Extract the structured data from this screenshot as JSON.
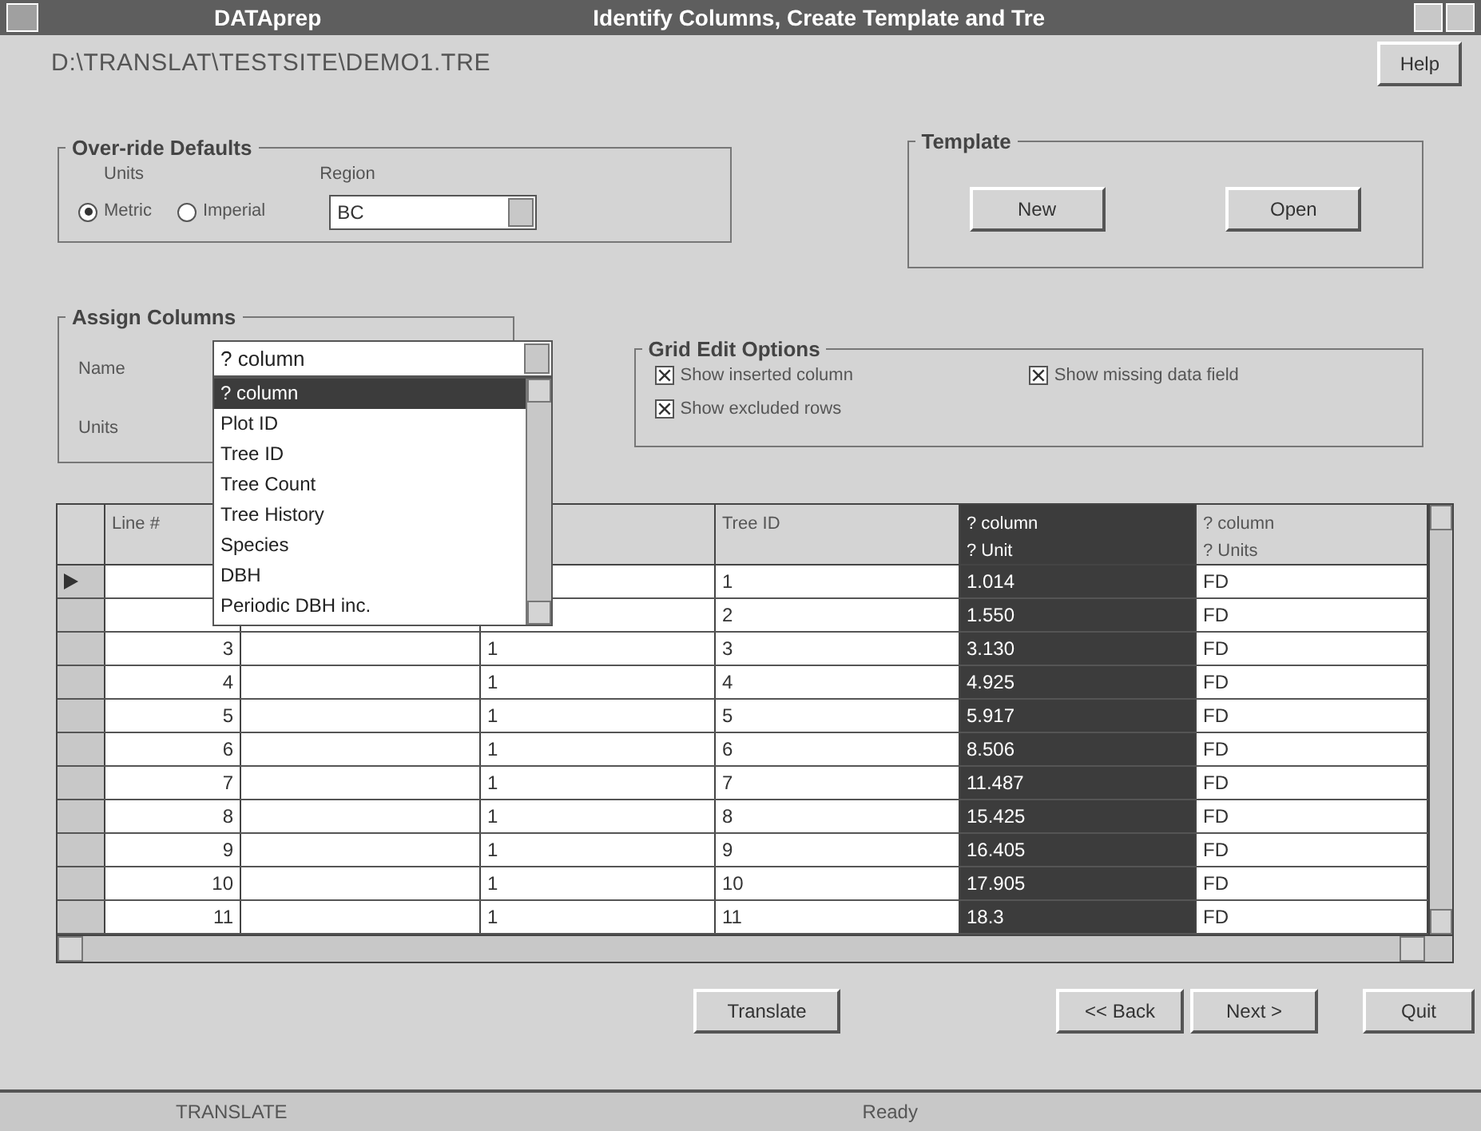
{
  "window": {
    "app_title": "DATAprep",
    "title": "Identify Columns, Create Template and Tre",
    "help_button": "Help"
  },
  "path": "D:\\TRANSLAT\\TESTSITE\\DEMO1.TRE",
  "override_defaults": {
    "title": "Over-ride Defaults",
    "units_label": "Units",
    "units": [
      {
        "label": "Metric",
        "selected": true
      },
      {
        "label": "Imperial",
        "selected": false
      }
    ],
    "region_label": "Region",
    "region": "BC"
  },
  "template": {
    "title": "Template",
    "buttons": [
      "New",
      "Open"
    ]
  },
  "assign_columns": {
    "title": "Assign Columns",
    "name_label": "Name",
    "units_label": "Units",
    "name_value": "? column",
    "options": [
      {
        "label": "? column",
        "selected": true
      },
      {
        "label": "Plot ID",
        "selected": false
      },
      {
        "label": "Tree ID",
        "selected": false
      },
      {
        "label": "Tree Count",
        "selected": false
      },
      {
        "label": "Tree History",
        "selected": false
      },
      {
        "label": "Species",
        "selected": false
      },
      {
        "label": "DBH",
        "selected": false
      },
      {
        "label": "Periodic DBH inc.",
        "selected": false
      }
    ]
  },
  "grid_edit_options": {
    "title": "Grid Edit Options",
    "options": [
      {
        "label": "Show inserted column",
        "checked": true
      },
      {
        "label": "Show missing data field",
        "checked": true
      },
      {
        "label": "Show excluded rows",
        "checked": true
      }
    ]
  },
  "table": {
    "columns": [
      {
        "label": "Line #",
        "selected": false
      },
      {
        "selected": false
      },
      {
        "selected": false
      },
      {
        "label": "Tree ID",
        "selected": false
      },
      {
        "label": "? column",
        "sublabel": "? Unit",
        "selected": true
      },
      {
        "label": "? column",
        "sublabel": "? Units",
        "selected": false
      }
    ],
    "rows": [
      {
        "current": true,
        "cells": [
          null,
          "",
          null,
          "1",
          "1.014",
          "FD"
        ]
      },
      {
        "current": false,
        "cells": [
          null,
          "",
          null,
          "2",
          "1.550",
          "FD"
        ]
      },
      {
        "current": false,
        "cells": [
          "3",
          "",
          "1",
          "3",
          "3.130",
          "FD"
        ]
      },
      {
        "current": false,
        "cells": [
          "4",
          "",
          "1",
          "4",
          "4.925",
          "FD"
        ]
      },
      {
        "current": false,
        "cells": [
          "5",
          "",
          "1",
          "5",
          "5.917",
          "FD"
        ]
      },
      {
        "current": false,
        "cells": [
          "6",
          "",
          "1",
          "6",
          "8.506",
          "FD"
        ]
      },
      {
        "current": false,
        "cells": [
          "7",
          "",
          "1",
          "7",
          "11.487",
          "FD"
        ]
      },
      {
        "current": false,
        "cells": [
          "8",
          "",
          "1",
          "8",
          "15.425",
          "FD"
        ]
      },
      {
        "current": false,
        "cells": [
          "9",
          "",
          "1",
          "9",
          "16.405",
          "FD"
        ]
      },
      {
        "current": false,
        "cells": [
          "10",
          "",
          "1",
          "10",
          "17.905",
          "FD"
        ]
      },
      {
        "current": false,
        "cells": [
          "11",
          "",
          "1",
          "11",
          "18.3",
          "FD"
        ]
      }
    ]
  },
  "buttons": [
    "Translate",
    "<< Back",
    "Next >",
    "Quit"
  ],
  "status_bar": [
    "TRANSLATE",
    "Ready"
  ]
}
